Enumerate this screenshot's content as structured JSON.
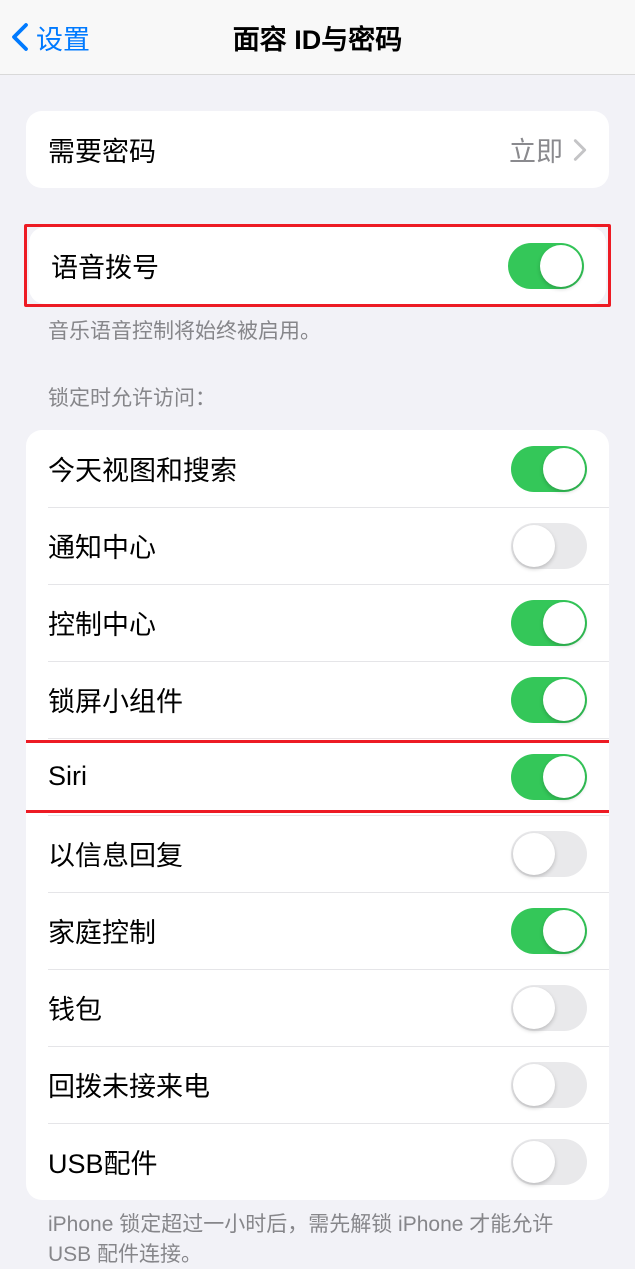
{
  "nav": {
    "back_label": "设置",
    "title": "面容 ID与密码"
  },
  "passcode_group": {
    "require_label": "需要密码",
    "require_value": "立即"
  },
  "voice_dial": {
    "label": "语音拨号",
    "footer": "音乐语音控制将始终被启用。"
  },
  "lock_access": {
    "header": "锁定时允许访问：",
    "items": [
      {
        "label": "今天视图和搜索",
        "on": true
      },
      {
        "label": "通知中心",
        "on": false
      },
      {
        "label": "控制中心",
        "on": true
      },
      {
        "label": "锁屏小组件",
        "on": true
      },
      {
        "label": "Siri",
        "on": true
      },
      {
        "label": "以信息回复",
        "on": false
      },
      {
        "label": "家庭控制",
        "on": true
      },
      {
        "label": "钱包",
        "on": false
      },
      {
        "label": "回拨未接来电",
        "on": false
      },
      {
        "label": "USB配件",
        "on": false
      }
    ],
    "footer": "iPhone 锁定超过一小时后，需先解锁 iPhone 才能允许 USB 配件连接。"
  }
}
